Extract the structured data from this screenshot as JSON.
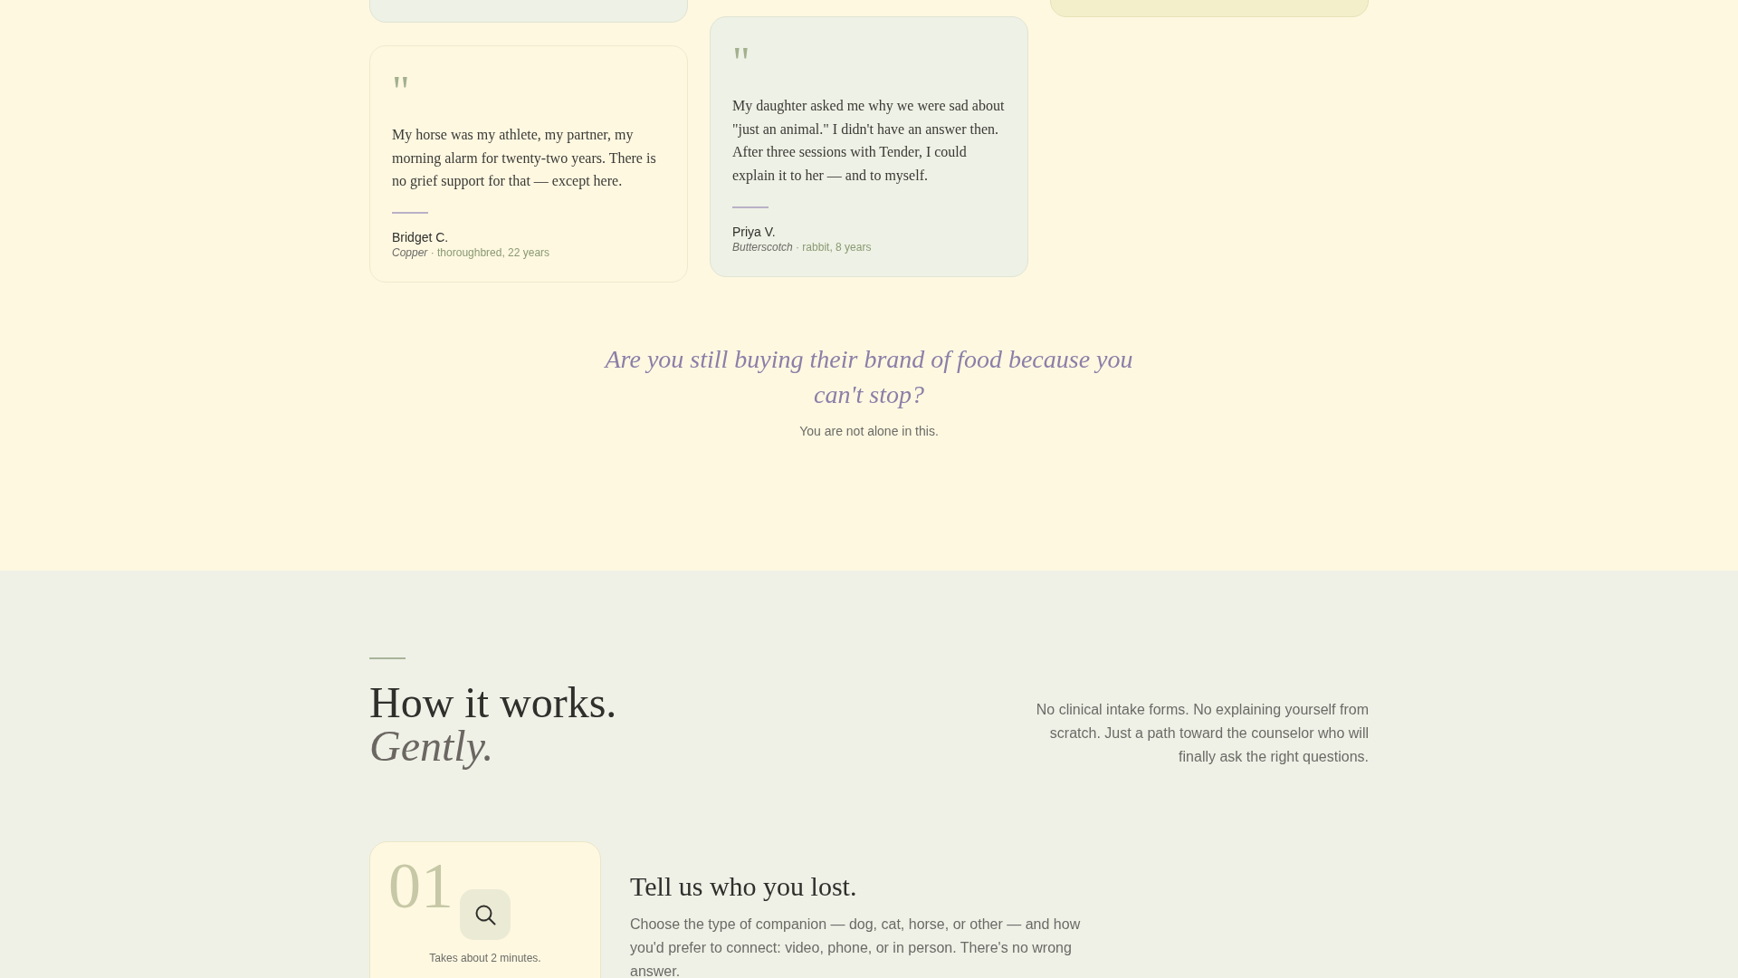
{
  "testimonials": {
    "columns": [
      [
        {
          "kind": "sage"
        },
        {
          "kind": "cream",
          "quote_mark": "\"",
          "quote": "My horse was my athlete, my partner, my morning alarm for twenty-two years. There is no grief support for that — except here.",
          "name": "Bridget C.",
          "pet": "*Copper* · thoroughbred, 22 years"
        }
      ],
      [
        {
          "kind": "sage",
          "quote_mark": "\"",
          "quote": "My daughter asked me why we were sad about \"just an animal.\" I didn't have an answer then. After three sessions with Tender, I could explain it to her — and to myself.",
          "name": "Priya V.",
          "pet": "*Butterscotch* · rabbit, 8 years"
        }
      ],
      [
        {
          "kind": "butter"
        }
      ]
    ]
  },
  "highlight": {
    "question": "Are you still buying their brand of food because you can't stop?",
    "note": "You are not alone in this."
  },
  "how_it_works": {
    "title": "How it works.",
    "title_emphasis": "Gently.",
    "intro": "No clinical intake forms. No explaining yourself from scratch. Just a path toward the counselor who will finally ask the right questions.",
    "steps": [
      {
        "number": "01",
        "duration": "Takes about 2 minutes.",
        "heading": "Tell us who you lost.",
        "text": "Choose the type of companion — dog, cat, horse, or other — and how you'd prefer to connect: video, phone, or in person. There's no wrong answer."
      }
    ]
  }
}
